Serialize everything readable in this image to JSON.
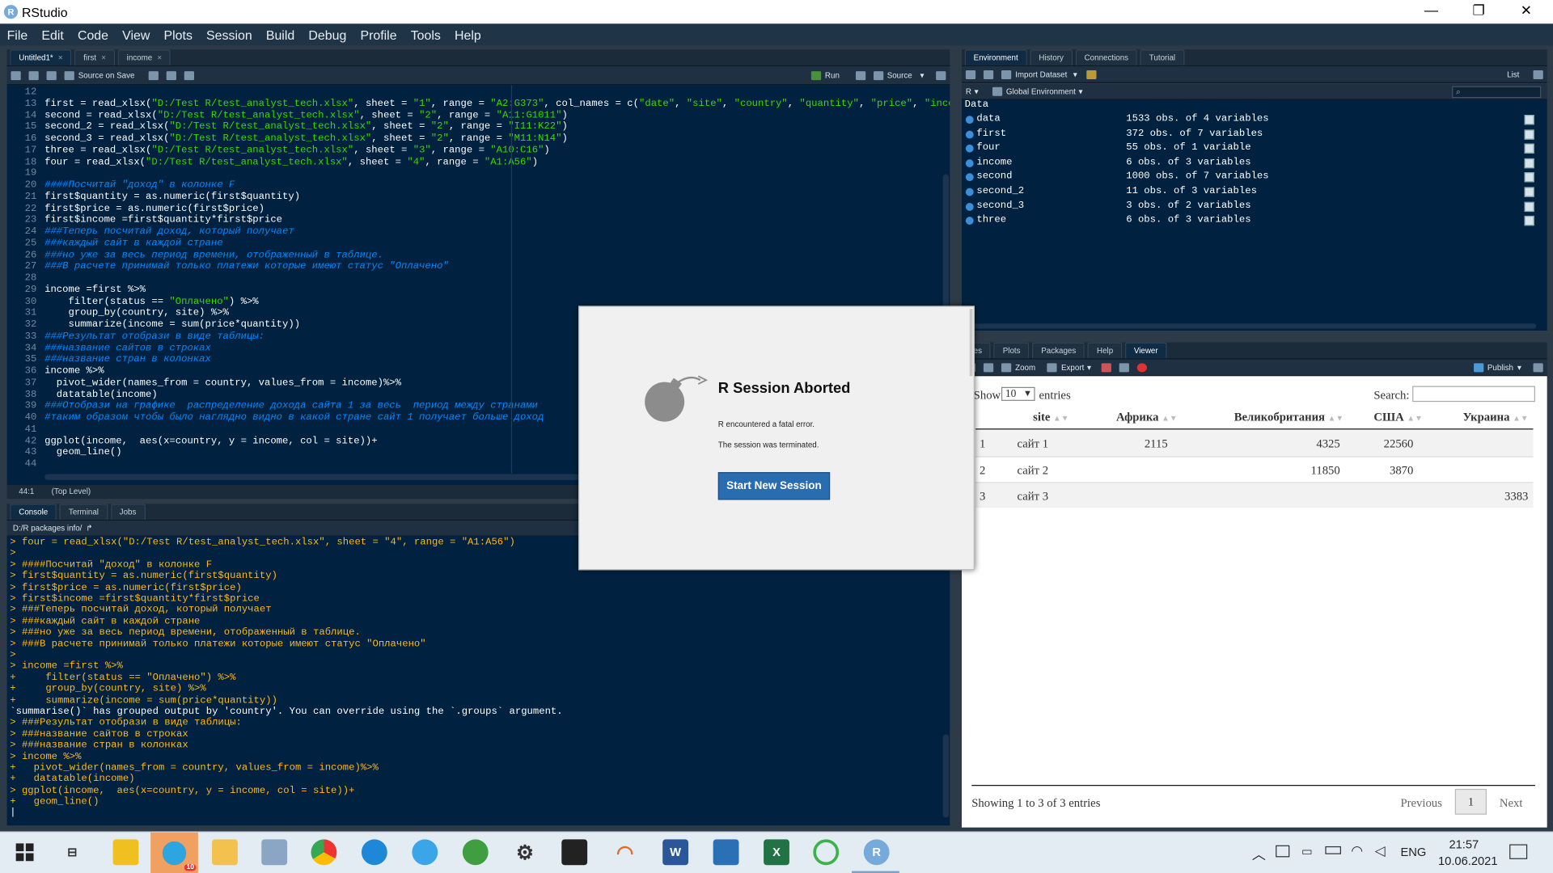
{
  "window": {
    "title": "RStudio",
    "logo": "R",
    "minimize": "—",
    "restore": "❐",
    "close": "✕"
  },
  "menu": [
    "File",
    "Edit",
    "Code",
    "View",
    "Plots",
    "Session",
    "Build",
    "Debug",
    "Profile",
    "Tools",
    "Help"
  ],
  "source_tabs": [
    {
      "label": "Untitled1*",
      "active": true
    },
    {
      "label": "first",
      "active": false
    },
    {
      "label": "income",
      "active": false
    }
  ],
  "source_toolbar": {
    "source_on_save": "Source on Save",
    "run": "Run",
    "source": "Source"
  },
  "editor": {
    "lines": [
      {
        "n": "12",
        "html": ""
      },
      {
        "n": "13",
        "html": "first = read_xlsx(<span class='st'>\"D:/Test R/test_analyst_tech.xlsx\"</span>, sheet = <span class='st'>\"1\"</span>, range = <span class='st'>\"A2:G373\"</span>, col_names = c(<span class='st'>\"date\"</span>, <span class='st'>\"site\"</span>, <span class='st'>\"country\"</span>, <span class='st'>\"quantity\"</span>, <span class='st'>\"price\"</span>, <span class='st'>\"incom</span>"
      },
      {
        "n": "14",
        "html": "second = read_xlsx(<span class='st'>\"D:/Test R/test_analyst_tech.xlsx\"</span>, sheet = <span class='st'>\"2\"</span>, range = <span class='st'>\"A11:G1011\"</span>)"
      },
      {
        "n": "15",
        "html": "second_2 = read_xlsx(<span class='st'>\"D:/Test R/test_analyst_tech.xlsx\"</span>, sheet = <span class='st'>\"2\"</span>, range = <span class='st'>\"I11:K22\"</span>)"
      },
      {
        "n": "16",
        "html": "second_3 = read_xlsx(<span class='st'>\"D:/Test R/test_analyst_tech.xlsx\"</span>, sheet = <span class='st'>\"2\"</span>, range = <span class='st'>\"M11:N14\"</span>)"
      },
      {
        "n": "17",
        "html": "three = read_xlsx(<span class='st'>\"D:/Test R/test_analyst_tech.xlsx\"</span>, sheet = <span class='st'>\"3\"</span>, range = <span class='st'>\"A10:C16\"</span>)"
      },
      {
        "n": "18",
        "html": "four = read_xlsx(<span class='st'>\"D:/Test R/test_analyst_tech.xlsx\"</span>, sheet = <span class='st'>\"4\"</span>, range = <span class='st'>\"A1:A56\"</span>)"
      },
      {
        "n": "19",
        "html": ""
      },
      {
        "n": "20",
        "html": "<span class='cm'>####Посчитай \"доход\" в колонке F</span>"
      },
      {
        "n": "21",
        "html": "first$quantity = as.numeric(first$quantity)"
      },
      {
        "n": "22",
        "html": "first$price = as.numeric(first$price)"
      },
      {
        "n": "23",
        "html": "first$income =first$quantity*first$price"
      },
      {
        "n": "24",
        "html": "<span class='cm'>###Теперь посчитай доход, который получает</span>"
      },
      {
        "n": "25",
        "html": "<span class='cm'>###каждый сайт в каждой стране</span>"
      },
      {
        "n": "26",
        "html": "<span class='cm'>###но уже за весь период времени, отображенный в таблице.</span>"
      },
      {
        "n": "27",
        "html": "<span class='cm'>###В расчете принимай только платежи которые имеют статус \"Оплачено\"</span>"
      },
      {
        "n": "28",
        "html": ""
      },
      {
        "n": "29",
        "html": "income =first %>%"
      },
      {
        "n": "30",
        "html": "    filter(status == <span class='st'>\"Оплачено\"</span>) %>%"
      },
      {
        "n": "31",
        "html": "    group_by(country, site) %>%"
      },
      {
        "n": "32",
        "html": "    summarize(income = sum(price*quantity))"
      },
      {
        "n": "33",
        "html": "<span class='cm'>###Результат отобрази в виде таблицы:</span>"
      },
      {
        "n": "34",
        "html": "<span class='cm'>###название сайтов в строках</span>"
      },
      {
        "n": "35",
        "html": "<span class='cm'>###название стран в колонках</span>"
      },
      {
        "n": "36",
        "html": "income %>%"
      },
      {
        "n": "37",
        "html": "  pivot_wider(names_from = country, values_from = income)%>%"
      },
      {
        "n": "38",
        "html": "  datatable(income)"
      },
      {
        "n": "39",
        "html": "<span class='cm'>###Отобрази на графике  распределение дохода сайта 1 за весь  период между странами</span>"
      },
      {
        "n": "40",
        "html": "<span class='cm'>#таким образом чтобы было наглядно видно в какой стране сайт 1 получает больше доход</span>"
      },
      {
        "n": "41",
        "html": ""
      },
      {
        "n": "42",
        "html": "ggplot(income,  aes(x=country, y = income, col = site))+"
      },
      {
        "n": "43",
        "html": "  geom_line()"
      },
      {
        "n": "44",
        "html": ""
      }
    ]
  },
  "editor_status": {
    "pos": "44:1",
    "scope": "(Top Level)"
  },
  "console_tabs": [
    "Console",
    "Terminal",
    "Jobs"
  ],
  "console_path": "D:/R packages info/",
  "console_lines": [
    {
      "t": "> four = read_xlsx(\"D:/Test R/test_analyst_tech.xlsx\", sheet = \"4\", range = \"A1:A56\")",
      "w": false
    },
    {
      "t": ">",
      "w": false
    },
    {
      "t": "> ####Посчитай \"доход\" в колонке F",
      "w": false
    },
    {
      "t": "> first$quantity = as.numeric(first$quantity)",
      "w": false
    },
    {
      "t": "> first$price = as.numeric(first$price)",
      "w": false
    },
    {
      "t": "> first$income =first$quantity*first$price",
      "w": false
    },
    {
      "t": "> ###Теперь посчитай доход, который получает",
      "w": false
    },
    {
      "t": "> ###каждый сайт в каждой стране",
      "w": false
    },
    {
      "t": "> ###но уже за весь период времени, отображенный в таблице.",
      "w": false
    },
    {
      "t": "> ###В расчете принимай только платежи которые имеют статус \"Оплачено\"",
      "w": false
    },
    {
      "t": ">",
      "w": false
    },
    {
      "t": "> income =first %>%",
      "w": false
    },
    {
      "t": "+     filter(status == \"Оплачено\") %>%",
      "w": false
    },
    {
      "t": "+     group_by(country, site) %>%",
      "w": false
    },
    {
      "t": "+     summarize(income = sum(price*quantity))",
      "w": false
    },
    {
      "t": "`summarise()` has grouped output by 'country'. You can override using the `.groups` argument.",
      "w": true
    },
    {
      "t": "> ###Результат отобрази в виде таблицы:",
      "w": false
    },
    {
      "t": "> ###название сайтов в строках",
      "w": false
    },
    {
      "t": "> ###название стран в колонках",
      "w": false
    },
    {
      "t": "> income %>%",
      "w": false
    },
    {
      "t": "+   pivot_wider(names_from = country, values_from = income)%>%",
      "w": false
    },
    {
      "t": "+   datatable(income)",
      "w": false
    },
    {
      "t": "> ggplot(income,  aes(x=country, y = income, col = site))+",
      "w": false
    },
    {
      "t": "+   geom_line()",
      "w": false
    }
  ],
  "env_tabs": [
    "Environment",
    "History",
    "Connections",
    "Tutorial"
  ],
  "env_toolbar": {
    "import": "Import Dataset",
    "list": "List",
    "lang": "R",
    "scope": "Global Environment"
  },
  "env_section": "Data",
  "env_rows": [
    {
      "name": "data",
      "desc": "1533 obs. of 4 variables"
    },
    {
      "name": "first",
      "desc": "372 obs. of 7 variables"
    },
    {
      "name": "four",
      "desc": "55 obs. of 1 variable"
    },
    {
      "name": "income",
      "desc": "6 obs. of 3 variables"
    },
    {
      "name": "second",
      "desc": "1000 obs. of 7 variables"
    },
    {
      "name": "second_2",
      "desc": "11 obs. of 3 variables"
    },
    {
      "name": "second_3",
      "desc": "3 obs. of 2 variables"
    },
    {
      "name": "three",
      "desc": "6 obs. of 3 variables"
    }
  ],
  "viewer_tabs": [
    "es",
    "Plots",
    "Packages",
    "Help",
    "Viewer"
  ],
  "viewer_toolbar": {
    "zoom": "Zoom",
    "export": "Export",
    "publish": "Publish"
  },
  "datatable": {
    "show": "Show",
    "entries_value": "10",
    "entries": "entries",
    "search": "Search:",
    "columns": [
      "site",
      "Африка",
      "Великобритания",
      "США",
      "Украина"
    ],
    "rows": [
      {
        "idx": "1",
        "site": "сайт 1",
        "africa": "2115",
        "uk": "4325",
        "usa": "22560",
        "ukraine": ""
      },
      {
        "idx": "2",
        "site": "сайт 2",
        "africa": "",
        "uk": "11850",
        "usa": "3870",
        "ukraine": ""
      },
      {
        "idx": "3",
        "site": "сайт 3",
        "africa": "",
        "uk": "",
        "usa": "",
        "ukraine": "3383"
      }
    ],
    "info": "Showing 1 to 3 of 3 entries",
    "prev": "Previous",
    "page": "1",
    "next": "Next"
  },
  "modal": {
    "title": "R Session Aborted",
    "line1": "R encountered a fatal error.",
    "line2": "The session was terminated.",
    "button": "Start New Session"
  },
  "taskbar": {
    "lang": "ENG",
    "time": "21:57",
    "date": "10.06.2021",
    "badge": "10"
  }
}
